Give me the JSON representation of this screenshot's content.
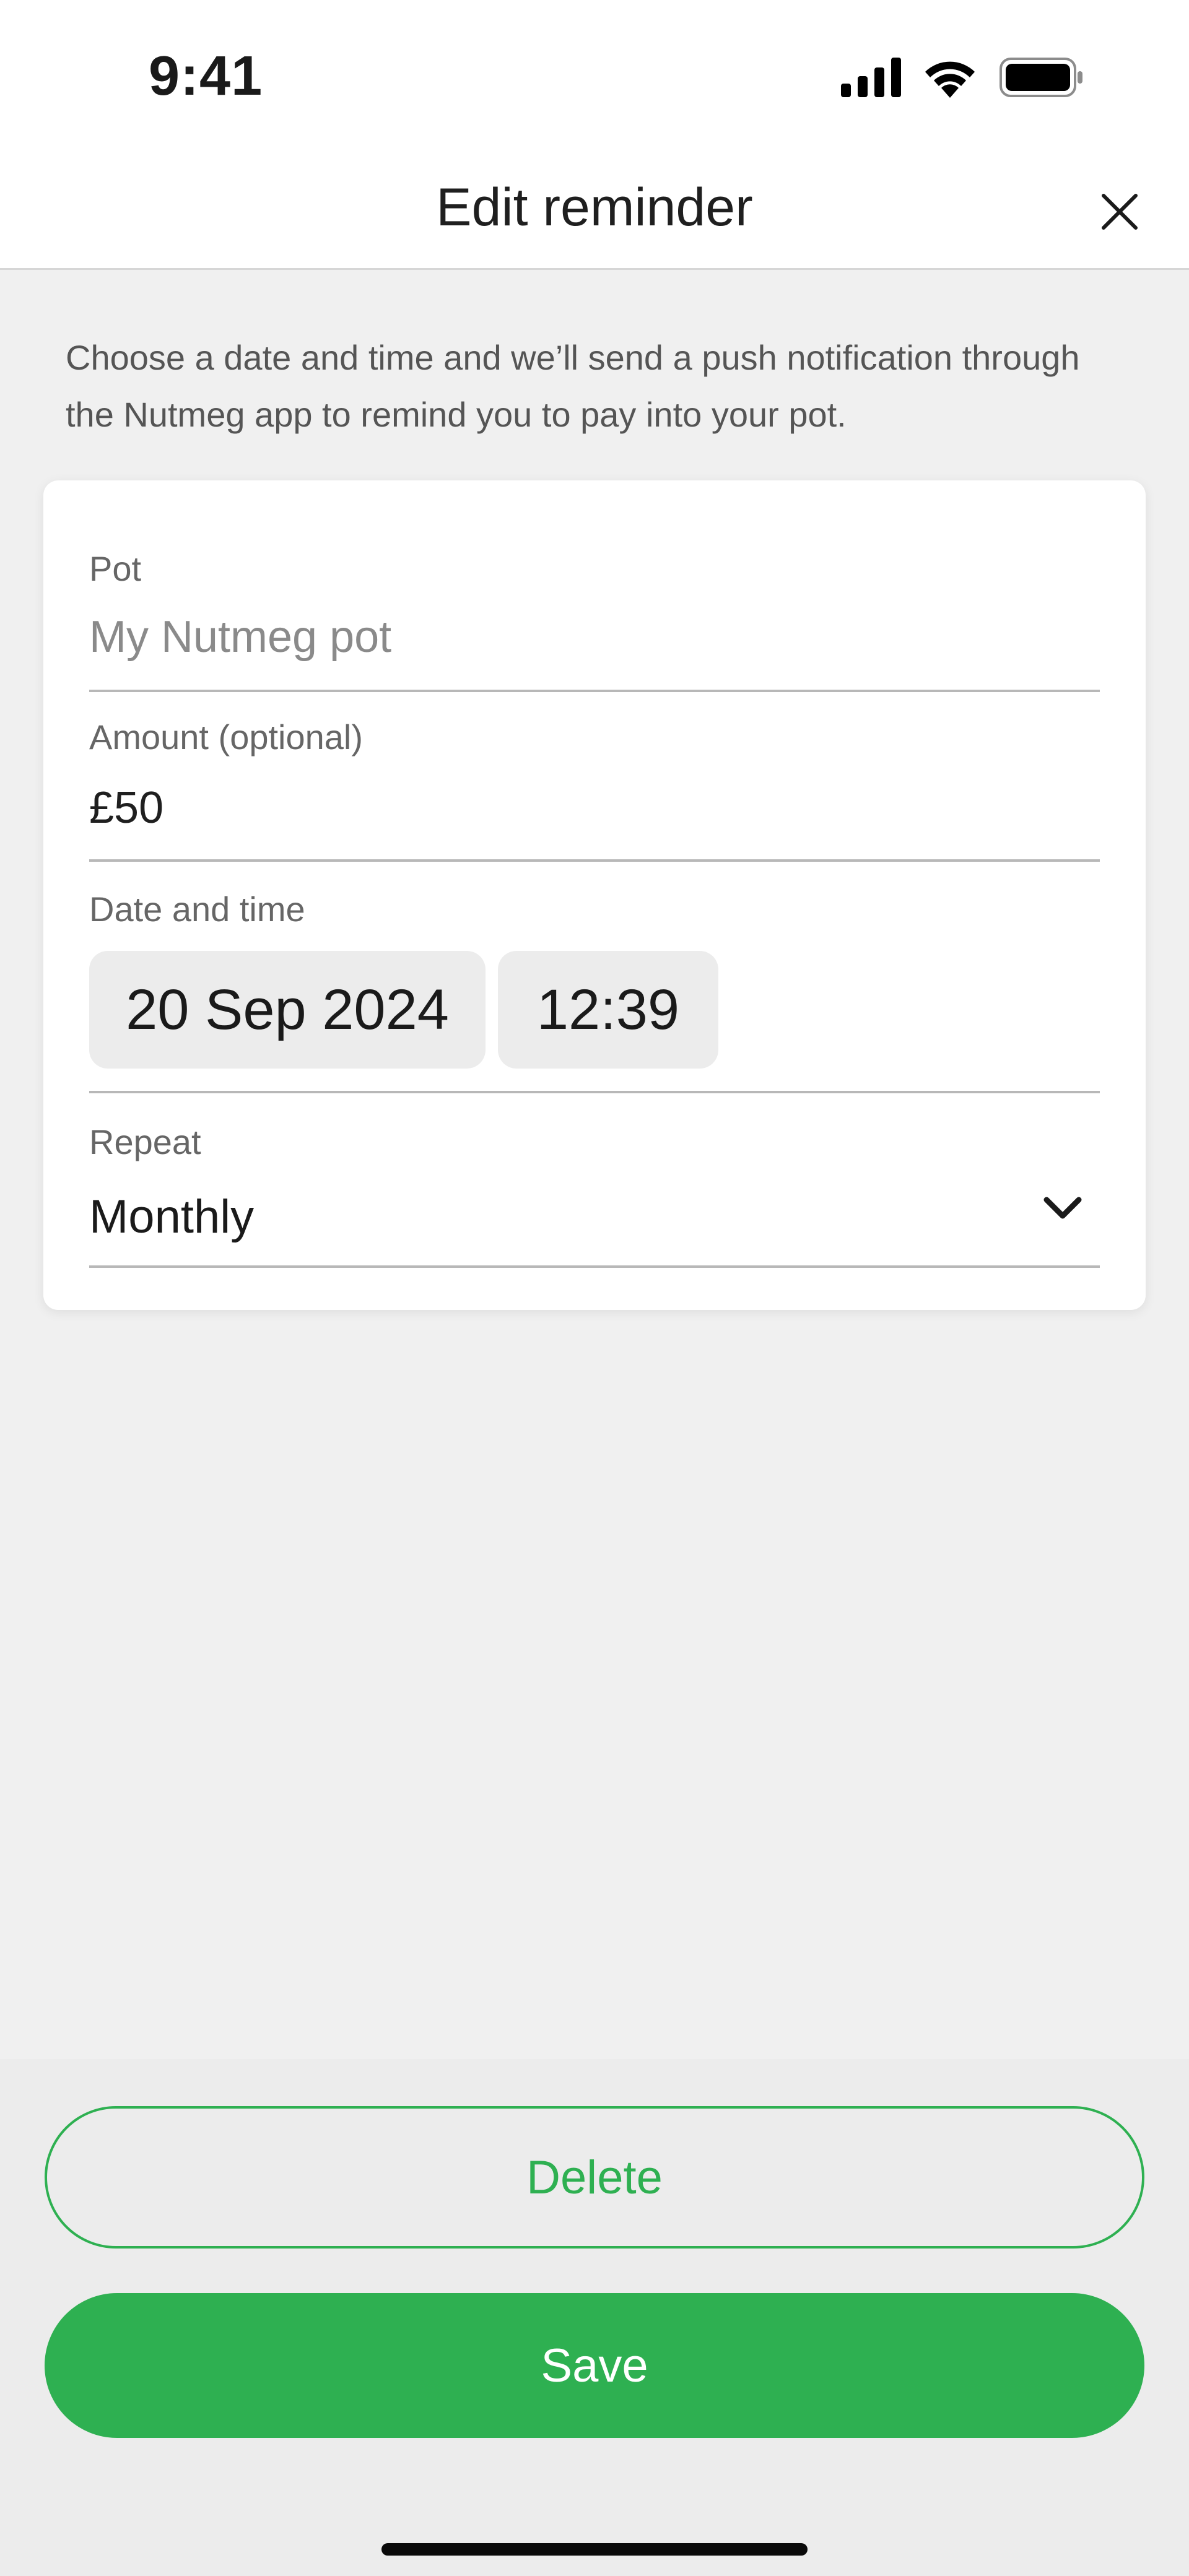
{
  "status_bar": {
    "time": "9:41",
    "icons": [
      "signal-icon",
      "wifi-icon",
      "battery-icon"
    ]
  },
  "header": {
    "title": "Edit reminder",
    "close_icon": "close-icon"
  },
  "intro": {
    "text": "Choose a date and time and we’ll send a push notification through the Nutmeg app to remind you to pay into your pot."
  },
  "form": {
    "pot": {
      "label": "Pot",
      "value": "My Nutmeg pot"
    },
    "amount": {
      "label": "Amount (optional)",
      "value": "£50"
    },
    "date_time": {
      "label": "Date and time",
      "date": "20 Sep 2024",
      "time": "12:39"
    },
    "repeat": {
      "label": "Repeat",
      "value": "Monthly",
      "icon": "chevron-down-icon"
    }
  },
  "actions": {
    "delete_label": "Delete",
    "save_label": "Save"
  },
  "colors": {
    "accent": "#2eb051",
    "background": "#f0f0f0",
    "card": "#ffffff"
  }
}
